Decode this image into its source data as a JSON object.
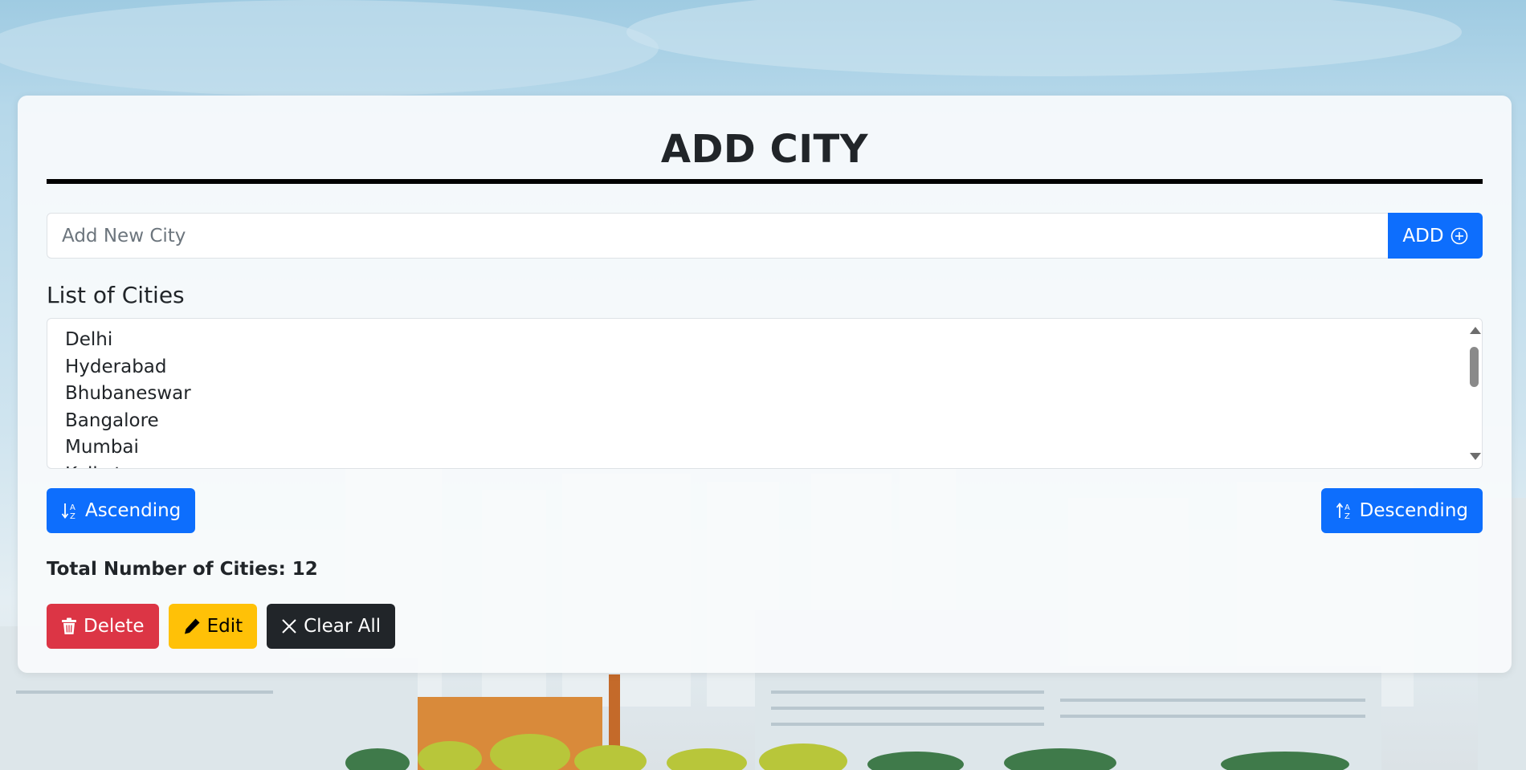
{
  "page": {
    "title": "ADD CITY"
  },
  "add_form": {
    "placeholder": "Add New City",
    "value": "",
    "add_label": "ADD"
  },
  "list": {
    "heading": "List of Cities",
    "cities": [
      "Delhi",
      "Hyderabad",
      "Bhubaneswar",
      "Bangalore",
      "Mumbai",
      "Kolkata"
    ]
  },
  "sort": {
    "ascending_label": "Ascending",
    "descending_label": "Descending"
  },
  "summary": {
    "total_text": "Total Number of Cities: 12"
  },
  "actions": {
    "delete_label": "Delete",
    "edit_label": "Edit",
    "clear_label": "Clear All"
  },
  "icons": {
    "add": "plus-circle-icon",
    "ascending": "sort-alpha-down-icon",
    "descending": "sort-alpha-up-icon",
    "delete": "trash-icon",
    "edit": "pencil-icon",
    "clear": "x-icon"
  },
  "colors": {
    "primary": "#0d6efd",
    "danger": "#dc3545",
    "warning": "#ffc107",
    "dark": "#212529"
  }
}
